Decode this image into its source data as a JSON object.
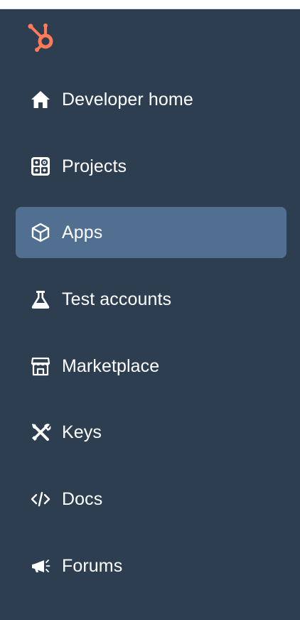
{
  "brand": {
    "logo_icon": "hubspot-sprocket-icon",
    "accent_color": "#ff7a59"
  },
  "colors": {
    "sidebar_bg": "#2d3e50",
    "active_bg": "#516f90",
    "text": "#ffffff"
  },
  "nav": {
    "items": [
      {
        "label": "Developer home",
        "icon": "home-icon",
        "active": false
      },
      {
        "label": "Projects",
        "icon": "projects-icon",
        "active": false
      },
      {
        "label": "Apps",
        "icon": "cube-icon",
        "active": true
      },
      {
        "label": "Test accounts",
        "icon": "flask-icon",
        "active": false
      },
      {
        "label": "Marketplace",
        "icon": "storefront-icon",
        "active": false
      },
      {
        "label": "Keys",
        "icon": "tools-icon",
        "active": false
      },
      {
        "label": "Docs",
        "icon": "code-icon",
        "active": false
      },
      {
        "label": "Forums",
        "icon": "megaphone-icon",
        "active": false
      }
    ]
  }
}
